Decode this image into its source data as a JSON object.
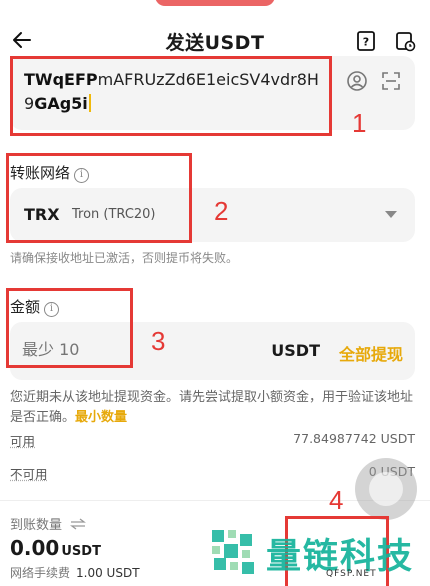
{
  "header": {
    "title": "发送USDT"
  },
  "address": {
    "prefix": "TWqEFP",
    "rest": "mAFRUzZd6E1eicSV4vdr8H9",
    "suffix": "GAg5i"
  },
  "network": {
    "label": "转账网络",
    "code": "TRX",
    "name": "Tron (TRC20)",
    "hint": "请确保接收地址已激活，否则提币将失败。"
  },
  "amount": {
    "label": "金额",
    "placeholder": "最少 10",
    "unit": "USDT",
    "all_button": "全部提现"
  },
  "note": {
    "text": "您近期未从该地址提现资金。请先尝试提取小额资金，用于验证该地址是否正确。",
    "highlight": "最小数量"
  },
  "balances": {
    "available_label": "可用",
    "available_value": "77.84987742 USDT",
    "unavailable_label": "不可用",
    "unavailable_value": "0 USDT"
  },
  "receive": {
    "label": "到账数量",
    "amount": "0.00",
    "unit": "USDT",
    "fee_label": "网络手续费",
    "fee_value": "1.00 USDT"
  },
  "annotations": [
    "1",
    "2",
    "3",
    "4"
  ],
  "watermark": {
    "text": "量链科技",
    "sub": "QFSP.NET"
  },
  "colors": {
    "accent": "#e7a90b",
    "annotation": "#e53935",
    "watermark": "#14b39b",
    "field_bg": "#f4f4f4"
  },
  "icons": [
    "back-arrow-icon",
    "help-icon",
    "history-icon",
    "contact-icon",
    "scan-icon",
    "info-icon",
    "dropdown-icon",
    "swap-icon"
  ]
}
